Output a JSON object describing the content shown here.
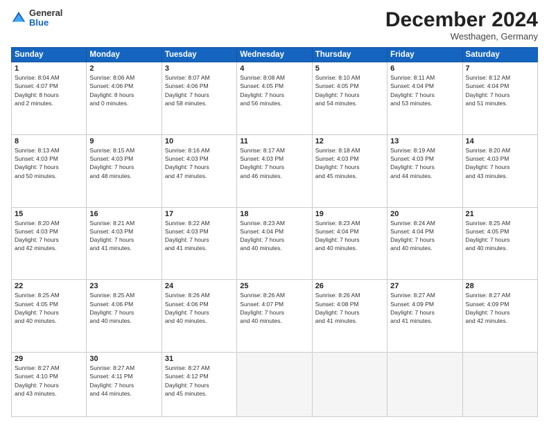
{
  "logo": {
    "general": "General",
    "blue": "Blue"
  },
  "title": "December 2024",
  "subtitle": "Westhagen, Germany",
  "days_header": [
    "Sunday",
    "Monday",
    "Tuesday",
    "Wednesday",
    "Thursday",
    "Friday",
    "Saturday"
  ],
  "weeks": [
    [
      {
        "day": "1",
        "info": "Sunrise: 8:04 AM\nSunset: 4:07 PM\nDaylight: 8 hours\nand 2 minutes."
      },
      {
        "day": "2",
        "info": "Sunrise: 8:06 AM\nSunset: 4:06 PM\nDaylight: 8 hours\nand 0 minutes."
      },
      {
        "day": "3",
        "info": "Sunrise: 8:07 AM\nSunset: 4:06 PM\nDaylight: 7 hours\nand 58 minutes."
      },
      {
        "day": "4",
        "info": "Sunrise: 8:08 AM\nSunset: 4:05 PM\nDaylight: 7 hours\nand 56 minutes."
      },
      {
        "day": "5",
        "info": "Sunrise: 8:10 AM\nSunset: 4:05 PM\nDaylight: 7 hours\nand 54 minutes."
      },
      {
        "day": "6",
        "info": "Sunrise: 8:11 AM\nSunset: 4:04 PM\nDaylight: 7 hours\nand 53 minutes."
      },
      {
        "day": "7",
        "info": "Sunrise: 8:12 AM\nSunset: 4:04 PM\nDaylight: 7 hours\nand 51 minutes."
      }
    ],
    [
      {
        "day": "8",
        "info": "Sunrise: 8:13 AM\nSunset: 4:03 PM\nDaylight: 7 hours\nand 50 minutes."
      },
      {
        "day": "9",
        "info": "Sunrise: 8:15 AM\nSunset: 4:03 PM\nDaylight: 7 hours\nand 48 minutes."
      },
      {
        "day": "10",
        "info": "Sunrise: 8:16 AM\nSunset: 4:03 PM\nDaylight: 7 hours\nand 47 minutes."
      },
      {
        "day": "11",
        "info": "Sunrise: 8:17 AM\nSunset: 4:03 PM\nDaylight: 7 hours\nand 46 minutes."
      },
      {
        "day": "12",
        "info": "Sunrise: 8:18 AM\nSunset: 4:03 PM\nDaylight: 7 hours\nand 45 minutes."
      },
      {
        "day": "13",
        "info": "Sunrise: 8:19 AM\nSunset: 4:03 PM\nDaylight: 7 hours\nand 44 minutes."
      },
      {
        "day": "14",
        "info": "Sunrise: 8:20 AM\nSunset: 4:03 PM\nDaylight: 7 hours\nand 43 minutes."
      }
    ],
    [
      {
        "day": "15",
        "info": "Sunrise: 8:20 AM\nSunset: 4:03 PM\nDaylight: 7 hours\nand 42 minutes."
      },
      {
        "day": "16",
        "info": "Sunrise: 8:21 AM\nSunset: 4:03 PM\nDaylight: 7 hours\nand 41 minutes."
      },
      {
        "day": "17",
        "info": "Sunrise: 8:22 AM\nSunset: 4:03 PM\nDaylight: 7 hours\nand 41 minutes."
      },
      {
        "day": "18",
        "info": "Sunrise: 8:23 AM\nSunset: 4:04 PM\nDaylight: 7 hours\nand 40 minutes."
      },
      {
        "day": "19",
        "info": "Sunrise: 8:23 AM\nSunset: 4:04 PM\nDaylight: 7 hours\nand 40 minutes."
      },
      {
        "day": "20",
        "info": "Sunrise: 8:24 AM\nSunset: 4:04 PM\nDaylight: 7 hours\nand 40 minutes."
      },
      {
        "day": "21",
        "info": "Sunrise: 8:25 AM\nSunset: 4:05 PM\nDaylight: 7 hours\nand 40 minutes."
      }
    ],
    [
      {
        "day": "22",
        "info": "Sunrise: 8:25 AM\nSunset: 4:05 PM\nDaylight: 7 hours\nand 40 minutes."
      },
      {
        "day": "23",
        "info": "Sunrise: 8:25 AM\nSunset: 4:06 PM\nDaylight: 7 hours\nand 40 minutes."
      },
      {
        "day": "24",
        "info": "Sunrise: 8:26 AM\nSunset: 4:06 PM\nDaylight: 7 hours\nand 40 minutes."
      },
      {
        "day": "25",
        "info": "Sunrise: 8:26 AM\nSunset: 4:07 PM\nDaylight: 7 hours\nand 40 minutes."
      },
      {
        "day": "26",
        "info": "Sunrise: 8:26 AM\nSunset: 4:08 PM\nDaylight: 7 hours\nand 41 minutes."
      },
      {
        "day": "27",
        "info": "Sunrise: 8:27 AM\nSunset: 4:09 PM\nDaylight: 7 hours\nand 41 minutes."
      },
      {
        "day": "28",
        "info": "Sunrise: 8:27 AM\nSunset: 4:09 PM\nDaylight: 7 hours\nand 42 minutes."
      }
    ],
    [
      {
        "day": "29",
        "info": "Sunrise: 8:27 AM\nSunset: 4:10 PM\nDaylight: 7 hours\nand 43 minutes."
      },
      {
        "day": "30",
        "info": "Sunrise: 8:27 AM\nSunset: 4:11 PM\nDaylight: 7 hours\nand 44 minutes."
      },
      {
        "day": "31",
        "info": "Sunrise: 8:27 AM\nSunset: 4:12 PM\nDaylight: 7 hours\nand 45 minutes."
      },
      {
        "day": "",
        "info": ""
      },
      {
        "day": "",
        "info": ""
      },
      {
        "day": "",
        "info": ""
      },
      {
        "day": "",
        "info": ""
      }
    ]
  ]
}
